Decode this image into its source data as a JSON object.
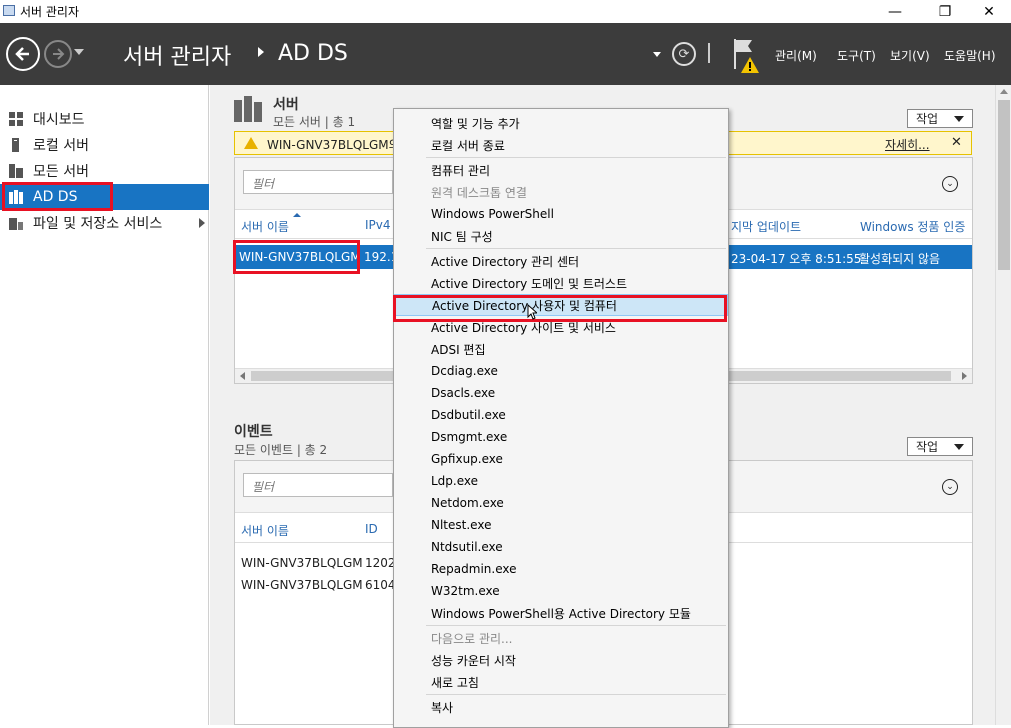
{
  "window": {
    "title": "서버 관리자",
    "minimize": "—",
    "maximize": "❐",
    "close": "✕"
  },
  "header": {
    "title": "서버 관리자",
    "subtitle": "AD DS",
    "menus": [
      "관리(M)",
      "도구(T)",
      "보기(V)",
      "도움말(H)"
    ]
  },
  "sidebar": {
    "items": [
      {
        "label": "대시보드",
        "icon": "dashboard-icon"
      },
      {
        "label": "로컬 서버",
        "icon": "local-server-icon"
      },
      {
        "label": "모든 서버",
        "icon": "all-servers-icon"
      },
      {
        "label": "AD DS",
        "icon": "ad-ds-icon",
        "active": true
      },
      {
        "label": "파일 및 저장소 서비스",
        "icon": "file-storage-icon",
        "has_children": true
      }
    ]
  },
  "servers": {
    "title": "서버",
    "subtitle": "모든 서버 | 총 1",
    "task_label": "작업",
    "warning_text": "WIN-GNV37BLQLGM의",
    "warning_more": "자세히...",
    "filter_placeholder": "필터",
    "columns": [
      "서버 이름",
      "IPv4",
      "지막 업데이트",
      "Windows 정품 인증"
    ],
    "row": {
      "name": "WIN-GNV37BLQLGM",
      "ip": "192.1",
      "last_update": "23-04-17 오후 8:51:55",
      "activation": "활성화되지 않음"
    }
  },
  "events": {
    "title": "이벤트",
    "subtitle": "모든 이벤트 | 총 2",
    "task_label": "작업",
    "filter_placeholder": "필터",
    "columns": [
      "서버 이름",
      "ID"
    ],
    "rows": [
      {
        "name": "WIN-GNV37BLQLGM",
        "id": "1202"
      },
      {
        "name": "WIN-GNV37BLQLGM",
        "id": "6104"
      }
    ]
  },
  "context_menu": {
    "items": [
      {
        "label": "역할 및 기능 추가"
      },
      {
        "label": "로컬 서버 종료"
      },
      {
        "sep": true
      },
      {
        "label": "컴퓨터 관리"
      },
      {
        "label": "원격 데스크톱 연결",
        "disabled": true
      },
      {
        "label": "Windows PowerShell"
      },
      {
        "label": "NIC 팀 구성"
      },
      {
        "sep": true
      },
      {
        "label": "Active Directory 관리 센터"
      },
      {
        "label": "Active Directory 도메인 및 트러스트"
      },
      {
        "label": "Active Directory 사용자 및 컴퓨터",
        "hover": true
      },
      {
        "label": "Active Directory 사이트 및 서비스"
      },
      {
        "label": "ADSI 편집"
      },
      {
        "label": "Dcdiag.exe"
      },
      {
        "label": "Dsacls.exe"
      },
      {
        "label": "Dsdbutil.exe"
      },
      {
        "label": "Dsmgmt.exe"
      },
      {
        "label": "Gpfixup.exe"
      },
      {
        "label": "Ldp.exe"
      },
      {
        "label": "Netdom.exe"
      },
      {
        "label": "Nltest.exe"
      },
      {
        "label": "Ntdsutil.exe"
      },
      {
        "label": "Repadmin.exe"
      },
      {
        "label": "W32tm.exe"
      },
      {
        "label": "Windows PowerShell용 Active Directory 모듈"
      },
      {
        "sep": true
      },
      {
        "label": "다음으로 관리...",
        "disabled": true
      },
      {
        "label": "성능 카운터 시작"
      },
      {
        "label": "새로 고침"
      },
      {
        "sep": true
      },
      {
        "label": "복사"
      }
    ]
  }
}
